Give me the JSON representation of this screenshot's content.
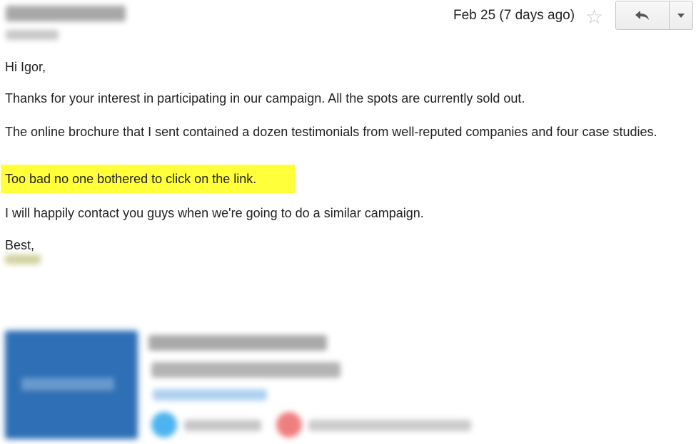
{
  "header": {
    "date": "Feb 25 (7 days ago)",
    "star_icon": "star-outline-icon",
    "reply_icon": "reply-icon",
    "more_icon": "dropdown-arrow-icon"
  },
  "body": {
    "greeting": "Hi Igor,",
    "paragraph_1": "Thanks for your interest in participating in our campaign. All the spots are currently sold out.",
    "paragraph_2": "The online brochure that I sent contained a dozen testimonials from well-reputed companies and four case studies.",
    "highlight": "Too bad no one bothered to click on the link.",
    "paragraph_4": "I will happily contact you guys when we're going to do a similar campaign.",
    "signoff": "Best,"
  },
  "colors": {
    "highlight": "#ffff3a",
    "signature_logo": "#2e6fb5",
    "skype_icon": "#4db4ef",
    "mail_icon": "#ef7f7f"
  }
}
